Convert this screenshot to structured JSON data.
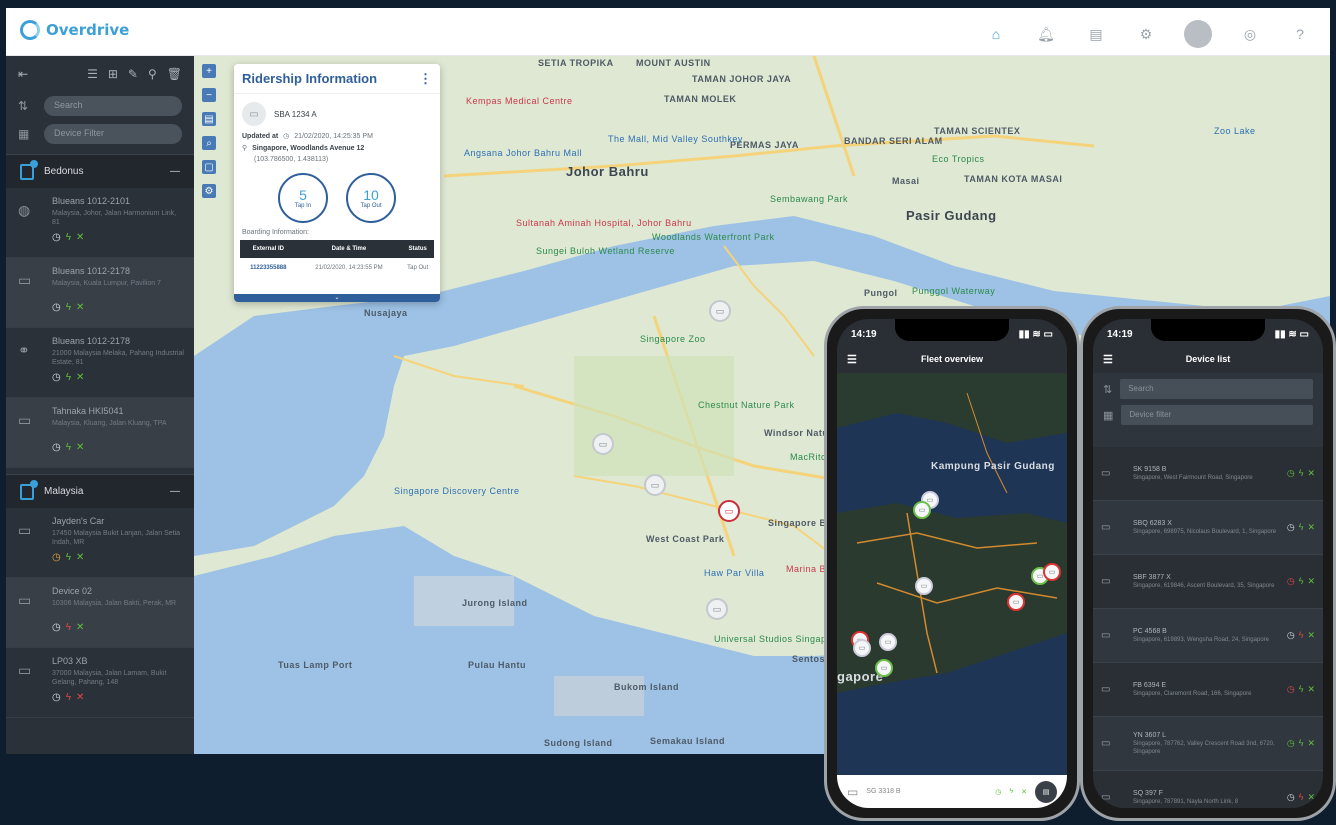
{
  "app": {
    "brand": "Overdrive"
  },
  "topbar": {
    "icons": [
      "home-icon",
      "bell-icon",
      "document-icon",
      "settings-icon",
      "avatar",
      "car-icon",
      "help-icon"
    ]
  },
  "sidebar": {
    "search_placeholder": "Search",
    "filter_placeholder": "Device Filter",
    "groups": [
      {
        "name": "Bedonus",
        "vehicles": [
          {
            "name": "Blueans 1012-2101",
            "addr": "Malaysia, Johor, Jalan Harmonium Link, 81",
            "icon": "sedan",
            "status": [
              "w",
              "g",
              "g"
            ]
          },
          {
            "name": "Blueans 1012-2178",
            "addr": "Malaysia, Kuala Lumpur, Pavilion 7",
            "icon": "car",
            "status": [
              "w",
              "g",
              "g"
            ]
          },
          {
            "name": "Blueans 1012-2178",
            "addr": "21000 Malaysia Melaka, Pahang Industrial Estate, 81",
            "icon": "bike",
            "status": [
              "w",
              "g",
              "g"
            ]
          },
          {
            "name": "Tahnaka HKI5041",
            "addr": "Malaysia, Kluang, Jalan Kluang, TPA",
            "icon": "car",
            "status": [
              "w",
              "g",
              "g"
            ]
          }
        ]
      },
      {
        "name": "Malaysia",
        "vehicles": [
          {
            "name": "Jayden's Car",
            "addr": "17450 Malaysia Bukit Lanjan, Jalan Setia Indah, MR",
            "icon": "car",
            "status": [
              "o",
              "g",
              "g"
            ]
          },
          {
            "name": "Device 02",
            "addr": "10306 Malaysia, Jalan Bakti, Perak, MR",
            "icon": "car",
            "status": [
              "w",
              "r",
              "g"
            ]
          },
          {
            "name": "LP03 XB",
            "addr": "37000 Malaysia, Jalan Lamam, Bukit Gelang, Pahang, 148",
            "icon": "car",
            "status": [
              "w",
              "r",
              "r"
            ]
          }
        ]
      }
    ]
  },
  "popup": {
    "title": "Ridership Information",
    "plate": "SBA 1234 A",
    "updated_label": "Updated at",
    "updated_value": "21/02/2020, 14:25:35 PM",
    "location": "Singapore, Woodlands Avenue 12",
    "coords": "(103.786500, 1.438113)",
    "tap_in_value": "5",
    "tap_in_label": "Tap In",
    "tap_out_value": "10",
    "tap_out_label": "Tap Out",
    "boarding_label": "Boarding Information:",
    "table": {
      "headers": [
        "External ID",
        "Date & Time",
        "Status"
      ],
      "rows": [
        [
          "11223355888",
          "21/02/2020, 14:23:55 PM",
          "Tap Out"
        ]
      ]
    }
  },
  "map": {
    "labels": [
      {
        "t": "SETIA TROPIKA"
      },
      {
        "t": "MOUNT AUSTIN"
      },
      {
        "t": "TAMAN JOHOR JAYA"
      },
      {
        "t": "TAMAN MOLEK"
      },
      {
        "t": "Johor Bahru"
      },
      {
        "t": "PERMAS JAYA"
      },
      {
        "t": "BANDAR SERI ALAM"
      },
      {
        "t": "TAMAN SCIENTEX"
      },
      {
        "t": "TAMAN KOTA MASAI"
      },
      {
        "t": "Pasir Gudang"
      },
      {
        "t": "Masai"
      },
      {
        "t": "Nusajaya"
      },
      {
        "t": "Jurong Island"
      },
      {
        "t": "Bukom Island"
      },
      {
        "t": "Sudong Island"
      },
      {
        "t": "Semakau Island"
      },
      {
        "t": "Sentosa"
      },
      {
        "t": "West Coast Park"
      },
      {
        "t": "Windsor Nature Park"
      },
      {
        "t": "Singapore Botanic Gardens"
      },
      {
        "t": "Tuas Lamp Port"
      },
      {
        "t": "Pulau Hantu"
      },
      {
        "t": "Pungol"
      }
    ],
    "pois": [
      {
        "t": "Kempas Medical Centre",
        "k": "red"
      },
      {
        "t": "The Mall, Mid Valley Southkey",
        "k": "blue"
      },
      {
        "t": "Angsana Johor Bahru Mall",
        "k": "blue"
      },
      {
        "t": "Sultanah Aminah Hospital, Johor Bahru",
        "k": "red"
      },
      {
        "t": "Eco Tropics",
        "k": "green"
      },
      {
        "t": "Sembawang Park",
        "k": "green"
      },
      {
        "t": "Woodlands Waterfront Park",
        "k": "green"
      },
      {
        "t": "Sungei Buloh Wetland Reserve",
        "k": "green"
      },
      {
        "t": "Singapore Zoo",
        "k": "green"
      },
      {
        "t": "Chestnut Nature Park",
        "k": "green"
      },
      {
        "t": "Singapore Discovery Centre",
        "k": "blue"
      },
      {
        "t": "MacRitchie Reservoir Park",
        "k": "green"
      },
      {
        "t": "Haw Par Villa",
        "k": "blue"
      },
      {
        "t": "Universal Studios Singapore",
        "k": "green"
      },
      {
        "t": "Marina Bay Sands Singapore",
        "k": "red"
      },
      {
        "t": "Punggol Waterway",
        "k": "green"
      },
      {
        "t": "Zoo Lake",
        "k": "blue"
      }
    ]
  },
  "phone1": {
    "time": "14:19",
    "title": "Fleet overview",
    "map_labels": [
      "Kampung Pasir Gudang",
      "gapore"
    ],
    "bottom_plate": "SG 3318 B"
  },
  "phone2": {
    "time": "14:19",
    "title": "Device list",
    "search": "Search",
    "filter": "Device filter",
    "items": [
      {
        "plate": "SK 9158 B",
        "addr": "Singapore, West Fairmount Road, Singapore",
        "status": [
          "g",
          "g",
          "g"
        ]
      },
      {
        "plate": "SBQ 6283 X",
        "addr": "Singapore, 698975, Nicolaus Boulevard, 1, Singapore",
        "status": [
          "w",
          "g",
          "g"
        ]
      },
      {
        "plate": "SBF 3877 X",
        "addr": "Singapore, 619846, Ascent Boulevard, 35, Singapore",
        "status": [
          "r",
          "g",
          "g"
        ]
      },
      {
        "plate": "PC 4568 B",
        "addr": "Singapore, 619893, Wengsha Road, 24, Singapore",
        "status": [
          "w",
          "r",
          "g"
        ]
      },
      {
        "plate": "FB 6394 E",
        "addr": "Singapore, Claremont Road, 166, Singapore",
        "status": [
          "r",
          "g",
          "g"
        ]
      },
      {
        "plate": "YN 3607 L",
        "addr": "Singapore, 787762, Valley Crescent Road 3nd, 6720, Singapore",
        "status": [
          "g",
          "g",
          "g"
        ]
      },
      {
        "plate": "SQ 397 F",
        "addr": "Singapore, 787891, Nayla North Link, 8",
        "status": [
          "w",
          "r",
          "g"
        ]
      }
    ]
  }
}
